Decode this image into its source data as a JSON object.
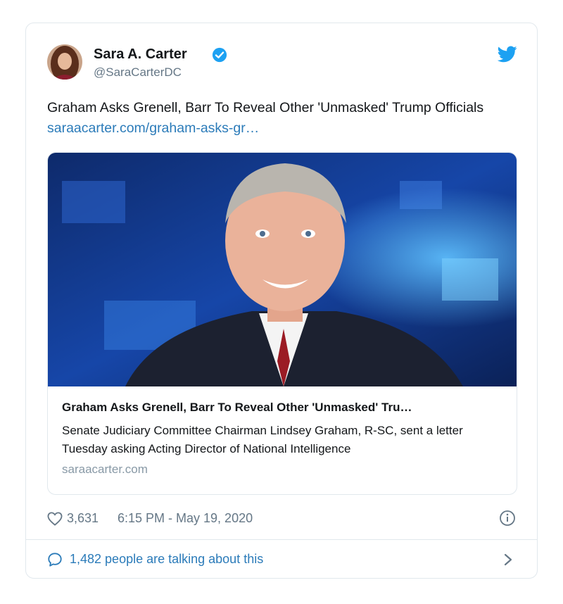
{
  "author": {
    "display_name": "Sara A. Carter",
    "handle": "@SaraCarterDC",
    "verified": true
  },
  "tweet": {
    "text": "Graham Asks Grenell, Barr To Reveal Other 'Unmasked' Trump Officials ",
    "link_text": "saraacarter.com/graham-asks-gr…"
  },
  "link_card": {
    "title": "Graham Asks Grenell, Barr To Reveal Other 'Unmasked' Tru…",
    "description": "Senate Judiciary Committee Chairman Lindsey Graham, R-SC, sent a letter Tuesday asking Acting Director of National Intelligence",
    "domain": "saraacarter.com"
  },
  "stats": {
    "like_count": "3,631",
    "timestamp": "6:15 PM - May 19, 2020"
  },
  "conversation": {
    "text": "1,482 people are talking about this"
  },
  "icons": {
    "verified": "verified-badge-icon",
    "brand": "twitter-bird-icon",
    "like": "heart-icon",
    "info": "info-icon",
    "comment": "comment-bubble-icon",
    "chevron": "chevron-right-icon"
  },
  "colors": {
    "accent": "#1da1f2",
    "link": "#2b7bb9",
    "secondary_text": "#657786",
    "border": "#e1e8ed"
  }
}
